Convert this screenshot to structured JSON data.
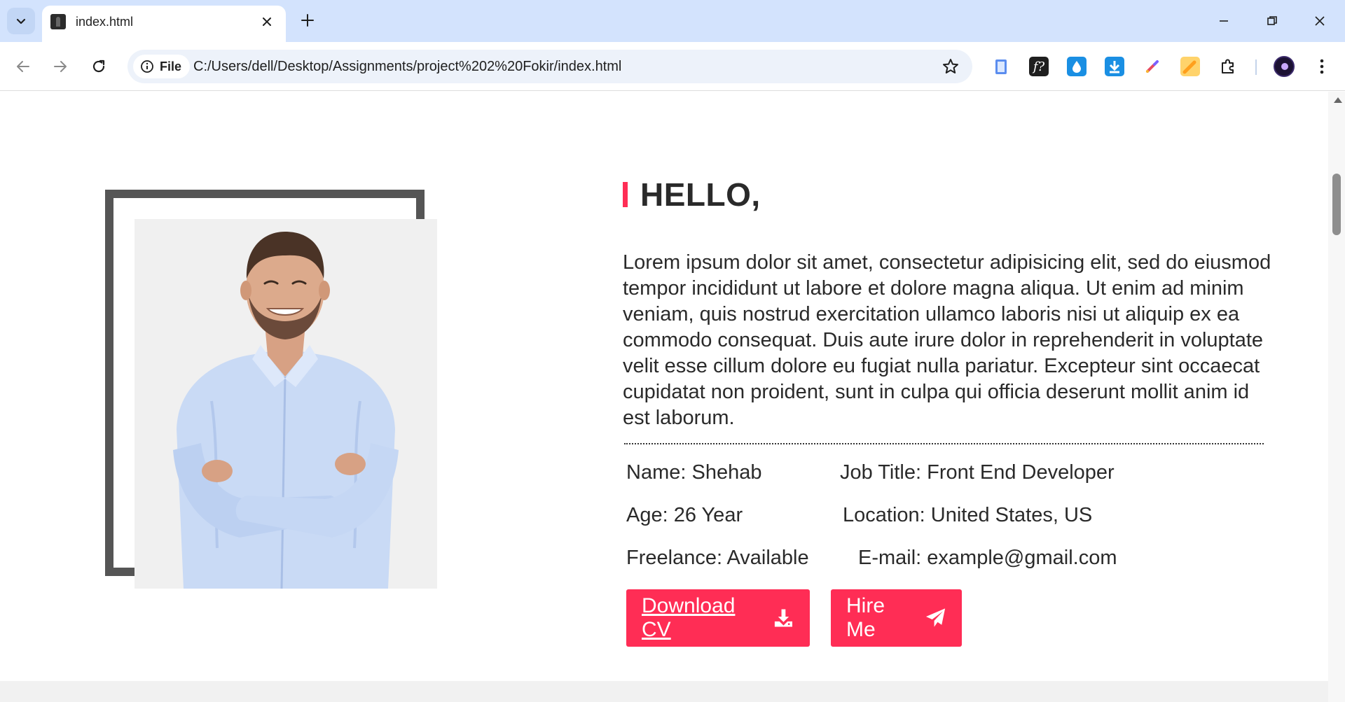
{
  "browser": {
    "tab_title": "index.html",
    "chip_label": "File",
    "url": "C:/Users/dell/Desktop/Assignments/project%202%20Fokir/index.html"
  },
  "hero": {
    "greeting": "HELLO,",
    "about": "Lorem ipsum dolor sit amet, consectetur adipisicing elit, sed do eiusmod tempor incididunt ut labore et dolore magna aliqua. Ut enim ad minim veniam, quis nostrud exercitation ullamco laboris nisi ut aliquip ex ea commodo consequat. Duis aute irure dolor in reprehenderit in voluptate velit esse cillum dolore eu fugiat nulla pariatur. Excepteur sint occaecat cupidatat non proident, sunt in culpa qui officia deserunt mollit anim id est laborum.",
    "info": {
      "name": "Name: Shehab",
      "job_title": "Job Title: Front End Developer",
      "age": "Age: 26 Year",
      "location": "Location: United States, US",
      "freelance": "Freelance: Available",
      "email": "E-mail: example@gmail.com"
    },
    "buttons": {
      "download_cv": "Download CV",
      "hire_me": "Hire Me"
    }
  },
  "colors": {
    "accent": "#ff2d55",
    "frame": "#555555",
    "tabbar": "#d3e3fd"
  },
  "icons": [
    "tab-search-icon",
    "close-icon",
    "plus-icon",
    "minimize-icon",
    "restore-icon",
    "back-arrow-icon",
    "forward-arrow-icon",
    "reload-icon",
    "info-icon",
    "star-icon",
    "extensions-puzzle-icon",
    "menu-dots-icon",
    "download-icon",
    "paper-plane-icon"
  ]
}
